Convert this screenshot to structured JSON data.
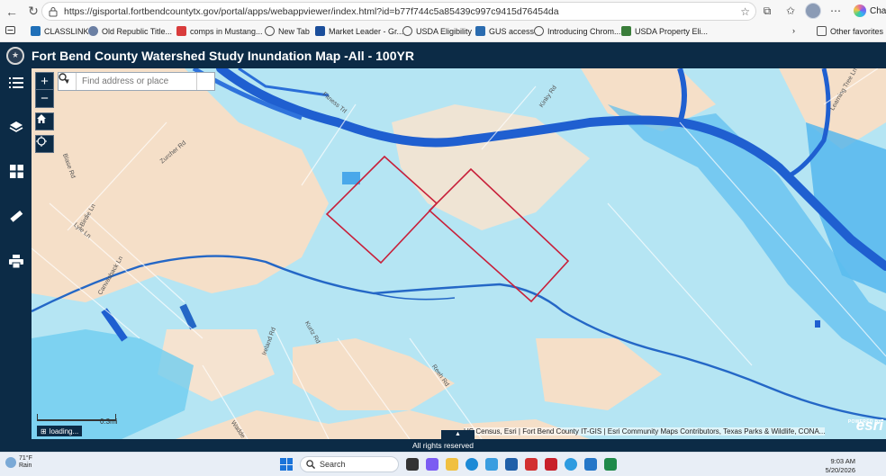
{
  "browser": {
    "url": "https://gisportal.fortbendcountytx.gov/portal/apps/webappviewer/index.html?id=b77f744c5a85439c997c9415d76454da",
    "chat_label": "Chat",
    "favorites": [
      {
        "label": "CLASSLINK",
        "color": "#1f6fb8"
      },
      {
        "label": "Old Republic Title...",
        "color": "#6b7fa3"
      },
      {
        "label": "comps in Mustang...",
        "color": "#d93c3c"
      },
      {
        "label": "New Tab",
        "color": "#777777"
      },
      {
        "label": "Market Leader - Gr...",
        "color": "#1b4e9b"
      },
      {
        "label": "USDA Eligibility",
        "color": "#555555"
      },
      {
        "label": "GUS access",
        "color": "#2b6cb0"
      },
      {
        "label": "Introducing Chrom...",
        "color": "#555555"
      },
      {
        "label": "USDA Property Eli...",
        "color": "#3a7d3a"
      }
    ],
    "other_favorites": "Other favorites"
  },
  "app": {
    "title": "Fort Bend County Watershed Study Inundation Map -All - 100YR",
    "search_placeholder": "Find address or place",
    "scale_label": "0.3mi",
    "loading_label": "loading...",
    "attribution": "US Census, Esri | Fort Bend County IT-GIS | Esri Community Maps Contributors, Texas Parks & Wildlife, CONA...",
    "esri_label": "esri",
    "esri_powered": "POWERED BY",
    "footer": "All rights reserved",
    "road_labels": [
      "Zurcher Rd",
      "Blase Rd",
      "Birdie Ln",
      "Lyle Ln",
      "Canvasback Ln",
      "Kurtz Rd",
      "Reeh Rd",
      "Ireland Rd",
      "Kinky Rd",
      "Learning Tree Ln",
      "Fitness Trl",
      "Wadde"
    ]
  },
  "taskbar": {
    "weather_temp": "71°F",
    "weather_desc": "Rain",
    "search_label": "Search",
    "time": "9:03 AM",
    "date": "5/20/2026"
  },
  "colors": {
    "app_header": "#0c2b46",
    "flood_light": "#9fe3f5",
    "flood_dark": "#1f5fd0",
    "land": "#f5dfc8",
    "parcel_outline": "#c8203a"
  }
}
